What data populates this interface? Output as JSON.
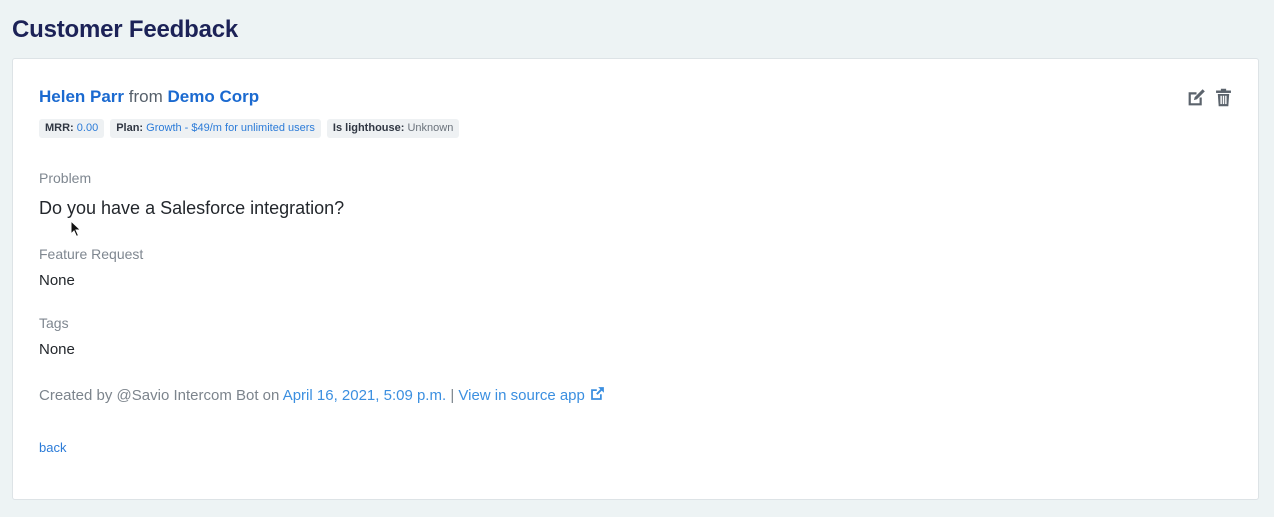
{
  "page": {
    "title": "Customer Feedback"
  },
  "feedback": {
    "person": "Helen Parr",
    "from_word": "from",
    "company": "Demo Corp",
    "badges": {
      "mrr_key": "MRR:",
      "mrr_value": "0.00",
      "plan_key": "Plan:",
      "plan_value": "Growth - $49/m for unlimited users",
      "lighthouse_key": "Is lighthouse:",
      "lighthouse_value": "Unknown"
    },
    "problem_label": "Problem",
    "problem_value": "Do you have a Salesforce integration?",
    "feature_label": "Feature Request",
    "feature_value": "None",
    "tags_label": "Tags",
    "tags_value": "None",
    "created_prefix": "Created by @Savio Intercom Bot on",
    "created_date": "April 16, 2021, 5:09 p.m.",
    "separator": "|",
    "view_source": "View in source app",
    "back": "back"
  },
  "icons": {
    "edit": "edit-icon",
    "delete": "trash-icon",
    "external": "external-link-icon"
  },
  "colors": {
    "title": "#1c2257",
    "link": "#1b6ad0",
    "light_link": "#3b8fe0",
    "background": "#edf3f4"
  }
}
